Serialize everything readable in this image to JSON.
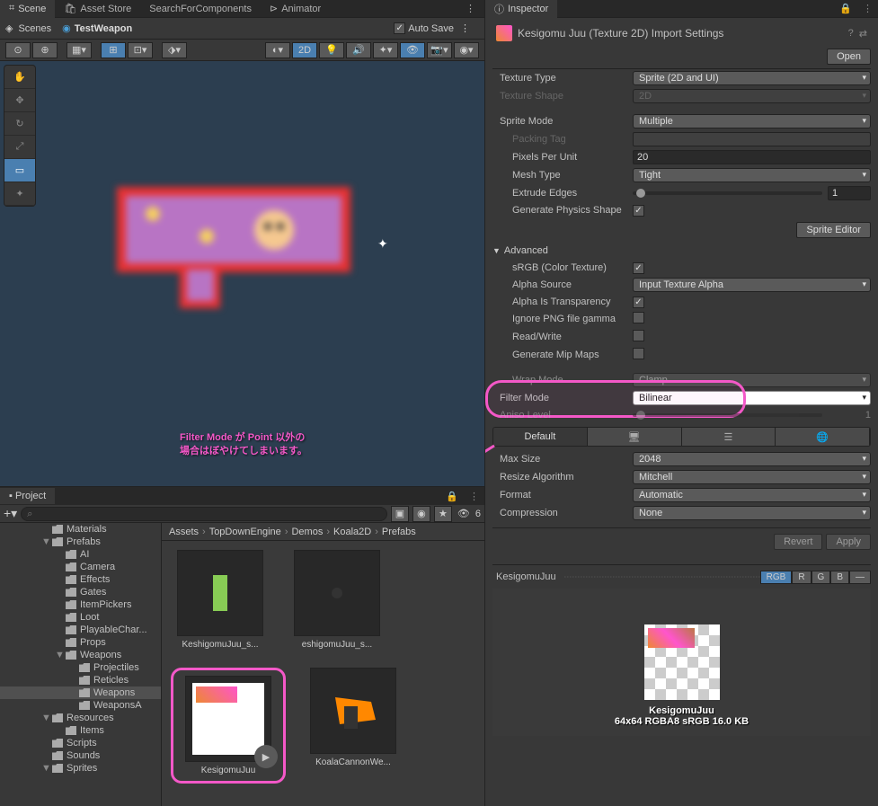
{
  "tabs": {
    "scene": "Scene",
    "assetStore": "Asset Store",
    "searchComponents": "SearchForComponents",
    "animator": "Animator"
  },
  "header": {
    "scenes": "Scenes",
    "testWeapon": "TestWeapon",
    "autoSave": "Auto Save"
  },
  "toolbar2d": "2D",
  "annotation": {
    "line1": "Filter Mode が Point 以外の",
    "line2": "場合はぼやけてしまいます。"
  },
  "project": {
    "tab": "Project",
    "hiddenCount": "6",
    "tree": [
      {
        "label": "Materials",
        "depth": 1
      },
      {
        "label": "Prefabs",
        "depth": 1,
        "arrow": "▼"
      },
      {
        "label": "AI",
        "depth": 2
      },
      {
        "label": "Camera",
        "depth": 2
      },
      {
        "label": "Effects",
        "depth": 2
      },
      {
        "label": "Gates",
        "depth": 2
      },
      {
        "label": "ItemPickers",
        "depth": 2
      },
      {
        "label": "Loot",
        "depth": 2
      },
      {
        "label": "PlayableChar...",
        "depth": 2
      },
      {
        "label": "Props",
        "depth": 2
      },
      {
        "label": "Weapons",
        "depth": 2,
        "arrow": "▼"
      },
      {
        "label": "Projectiles",
        "depth": 3
      },
      {
        "label": "Reticles",
        "depth": 3
      },
      {
        "label": "Weapons",
        "depth": 3,
        "selected": true
      },
      {
        "label": "WeaponsA",
        "depth": 3
      },
      {
        "label": "Resources",
        "depth": 1,
        "arrow": "▼"
      },
      {
        "label": "Items",
        "depth": 2
      },
      {
        "label": "Scripts",
        "depth": 1
      },
      {
        "label": "Sounds",
        "depth": 1
      },
      {
        "label": "Sprites",
        "depth": 1,
        "arrow": "▼"
      }
    ],
    "breadcrumb": [
      "Assets",
      "TopDownEngine",
      "Demos",
      "Koala2D",
      "Prefabs"
    ],
    "items": [
      {
        "label": "KeshigomuJuu_s..."
      },
      {
        "label": "eshigomuJuu_s..."
      },
      {
        "label": "KesigomuJuu",
        "highlighted": true
      },
      {
        "label": "KoalaCannonWe..."
      }
    ]
  },
  "inspector": {
    "tab": "Inspector",
    "title": "Kesigomu Juu (Texture 2D) Import Settings",
    "openBtn": "Open",
    "spriteEditorBtn": "Sprite Editor",
    "props": {
      "textureType": {
        "label": "Texture Type",
        "value": "Sprite (2D and UI)"
      },
      "textureShape": {
        "label": "Texture Shape",
        "value": "2D"
      },
      "spriteMode": {
        "label": "Sprite Mode",
        "value": "Multiple"
      },
      "packingTag": {
        "label": "Packing Tag",
        "value": ""
      },
      "ppu": {
        "label": "Pixels Per Unit",
        "value": "20"
      },
      "meshType": {
        "label": "Mesh Type",
        "value": "Tight"
      },
      "extrudeEdges": {
        "label": "Extrude Edges",
        "value": "1"
      },
      "genPhysics": {
        "label": "Generate Physics Shape"
      }
    },
    "advanced": {
      "header": "Advanced",
      "srgb": "sRGB (Color Texture)",
      "alphaSource": {
        "label": "Alpha Source",
        "value": "Input Texture Alpha"
      },
      "alphaTrans": "Alpha Is Transparency",
      "ignorePng": "Ignore PNG file gamma",
      "readWrite": "Read/Write",
      "mipMaps": "Generate Mip Maps"
    },
    "filterMode": {
      "label": "Filter Mode",
      "value": "Bilinear"
    },
    "anisoValue": "1",
    "platform": {
      "default": "Default",
      "maxSize": {
        "label": "Max Size",
        "value": "2048"
      },
      "resize": {
        "label": "Resize Algorithm",
        "value": "Mitchell"
      },
      "format": {
        "label": "Format",
        "value": "Automatic"
      },
      "compression": {
        "label": "Compression",
        "value": "None"
      }
    },
    "revert": "Revert",
    "apply": "Apply",
    "preview": {
      "name": "KesigomuJuu",
      "rgb": "RGB",
      "r": "R",
      "g": "G",
      "b": "B",
      "meta1": "KesigomuJuu",
      "meta2": "64x64  RGBA8 sRGB  16.0 KB"
    }
  }
}
